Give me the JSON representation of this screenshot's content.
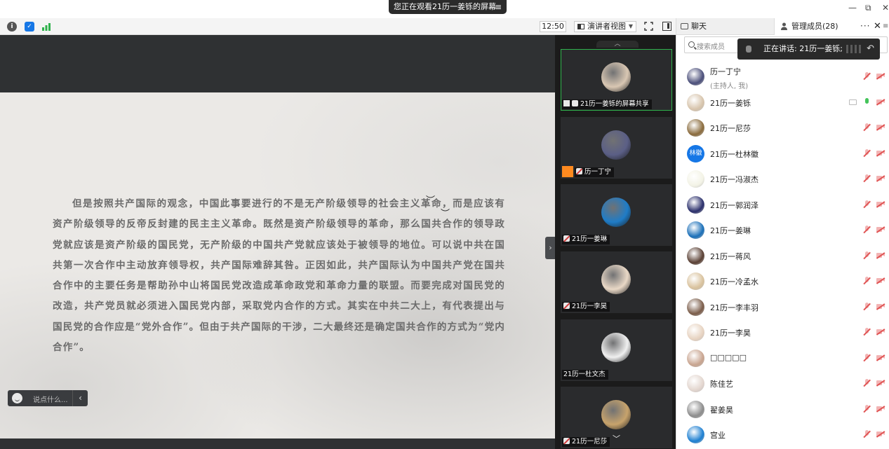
{
  "window": {
    "viewing_banner": "您正在观看21历一姜铄的屏幕",
    "minimize": "—",
    "restore": "⧉",
    "close": "✕"
  },
  "toolbar": {
    "clock": "12:50",
    "view_mode": "演讲者视图"
  },
  "slide": {
    "paragraph": "但是按照共产国际的观念，中国此事要进行的不是无产阶级领导的社会主义革命，而是应该有资产阶级领导的反帝反封建的民主主义革命。既然是资产阶级领导的革命，那么国共合作的领导政党就应该是资产阶级的国民党，无产阶级的中国共产党就应该处于被领导的地位。可以说中共在国共第一次合作中主动放弃领导权，共产国际难辞其咎。正因如此，共产国际认为中国共产党在国共合作中的主要任务是帮助孙中山将国民党改造成革命政党和革命力量的联盟。而要完成对国民党的改造，共产党员就必须进入国民党内部，采取党内合作的方式。其实在中共二大上，有代表提出与国民党的合作应是“党外合作”。但由于共产国际的干涉，二大最终还是确定国共合作的方式为“党内合作”。"
  },
  "chat_input": {
    "placeholder": "说点什么..."
  },
  "video_tiles": [
    {
      "label": "21历一姜铄的屏幕共享",
      "color": "#d9c7b3",
      "active": true
    },
    {
      "label": "历一丁宁",
      "color": "#5b5f86",
      "active": false
    },
    {
      "label": "21历一姜琳",
      "color": "#1f7cc7",
      "active": false
    },
    {
      "label": "21历一李昊",
      "color": "#e9d8c6",
      "active": false
    },
    {
      "label": "21历一杜文杰",
      "color": "#f0f0f0",
      "active": false
    },
    {
      "label": "21历一尼莎",
      "color": "#c7a36c",
      "active": false
    }
  ],
  "side_panel": {
    "tab_chat": "聊天",
    "tab_members": "管理成员(28)",
    "more": "···",
    "close": "✕",
    "search_placeholder": "搜索成员",
    "speaking": "正在讲话: 21历一姜铄;"
  },
  "members": [
    {
      "name": "历一丁宁",
      "sub": "(主持人, 我)",
      "color": "#4b4f7a",
      "mic_on": false
    },
    {
      "name": "21历一姜铄",
      "sub": "",
      "color": "#d7c4ac",
      "mic_on": true
    },
    {
      "name": "21历一尼莎",
      "sub": "",
      "color": "#8a6b3c",
      "mic_on": false
    },
    {
      "name": "21历一杜林徽",
      "sub": "",
      "color": "#1677e6",
      "mic_on": false,
      "initials": "林徽"
    },
    {
      "name": "21历一冯淑杰",
      "sub": "",
      "color": "#f3f3e6",
      "mic_on": false
    },
    {
      "name": "21历一郭润泽",
      "sub": "",
      "color": "#2a2f6b",
      "mic_on": false
    },
    {
      "name": "21历一姜琳",
      "sub": "",
      "color": "#1a6fb8",
      "mic_on": false
    },
    {
      "name": "21历一蒋风",
      "sub": "",
      "color": "#5a4034",
      "mic_on": false
    },
    {
      "name": "21历一冷孟水",
      "sub": "",
      "color": "#d9c29d",
      "mic_on": false
    },
    {
      "name": "21历一李丰羽",
      "sub": "",
      "color": "#7a5c49",
      "mic_on": false
    },
    {
      "name": "21历一李昊",
      "sub": "",
      "color": "#e7d3c1",
      "mic_on": false
    },
    {
      "name": "□□□□□",
      "sub": "",
      "color": "#c8a48f",
      "mic_on": false
    },
    {
      "name": "陈佳艺",
      "sub": "",
      "color": "#e3d6cf",
      "mic_on": false
    },
    {
      "name": "翟姜昊",
      "sub": "",
      "color": "#8c8c8c",
      "mic_on": false
    },
    {
      "name": "宫业",
      "sub": "",
      "color": "#1d7fd1",
      "mic_on": false
    }
  ]
}
